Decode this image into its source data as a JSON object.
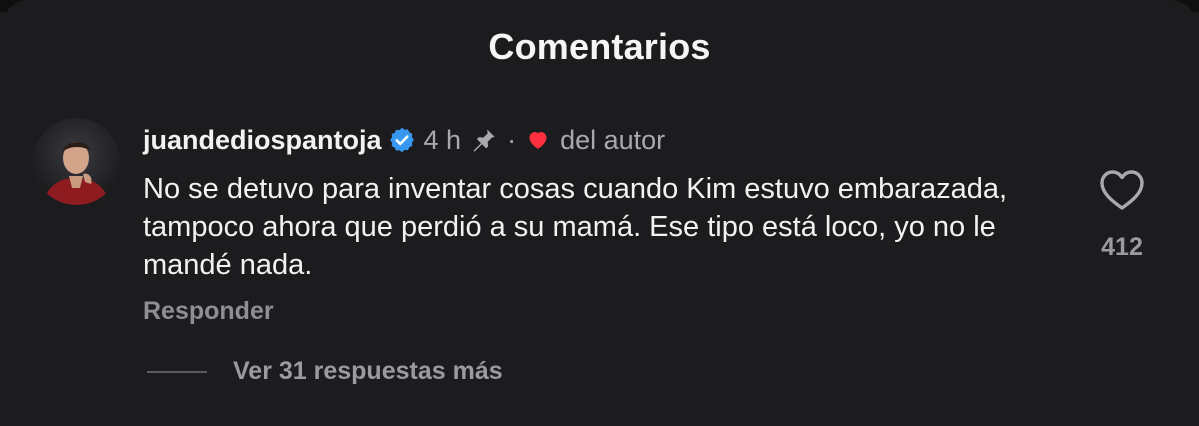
{
  "header": {
    "title": "Comentarios"
  },
  "comment": {
    "username": "juandediospantoja",
    "verified_icon": "verified-badge-icon",
    "time": "4 h",
    "pinned_icon": "pin-icon",
    "separator": "·",
    "author_like_icon": "heart-icon",
    "author_label": "del autor",
    "text": "No se detuvo para inventar cosas cuando Kim estuvo embarazada, tampoco ahora que perdió a su mamá. Ese tipo está loco, yo no le mandé nada.",
    "reply_label": "Responder",
    "like_count": "412",
    "more_replies_label": "Ver 31 respuestas más"
  },
  "colors": {
    "background": "#1c1c1f",
    "verified": "#3897f0",
    "heart": "#ff3040",
    "muted_text": "#a8a8ad"
  }
}
